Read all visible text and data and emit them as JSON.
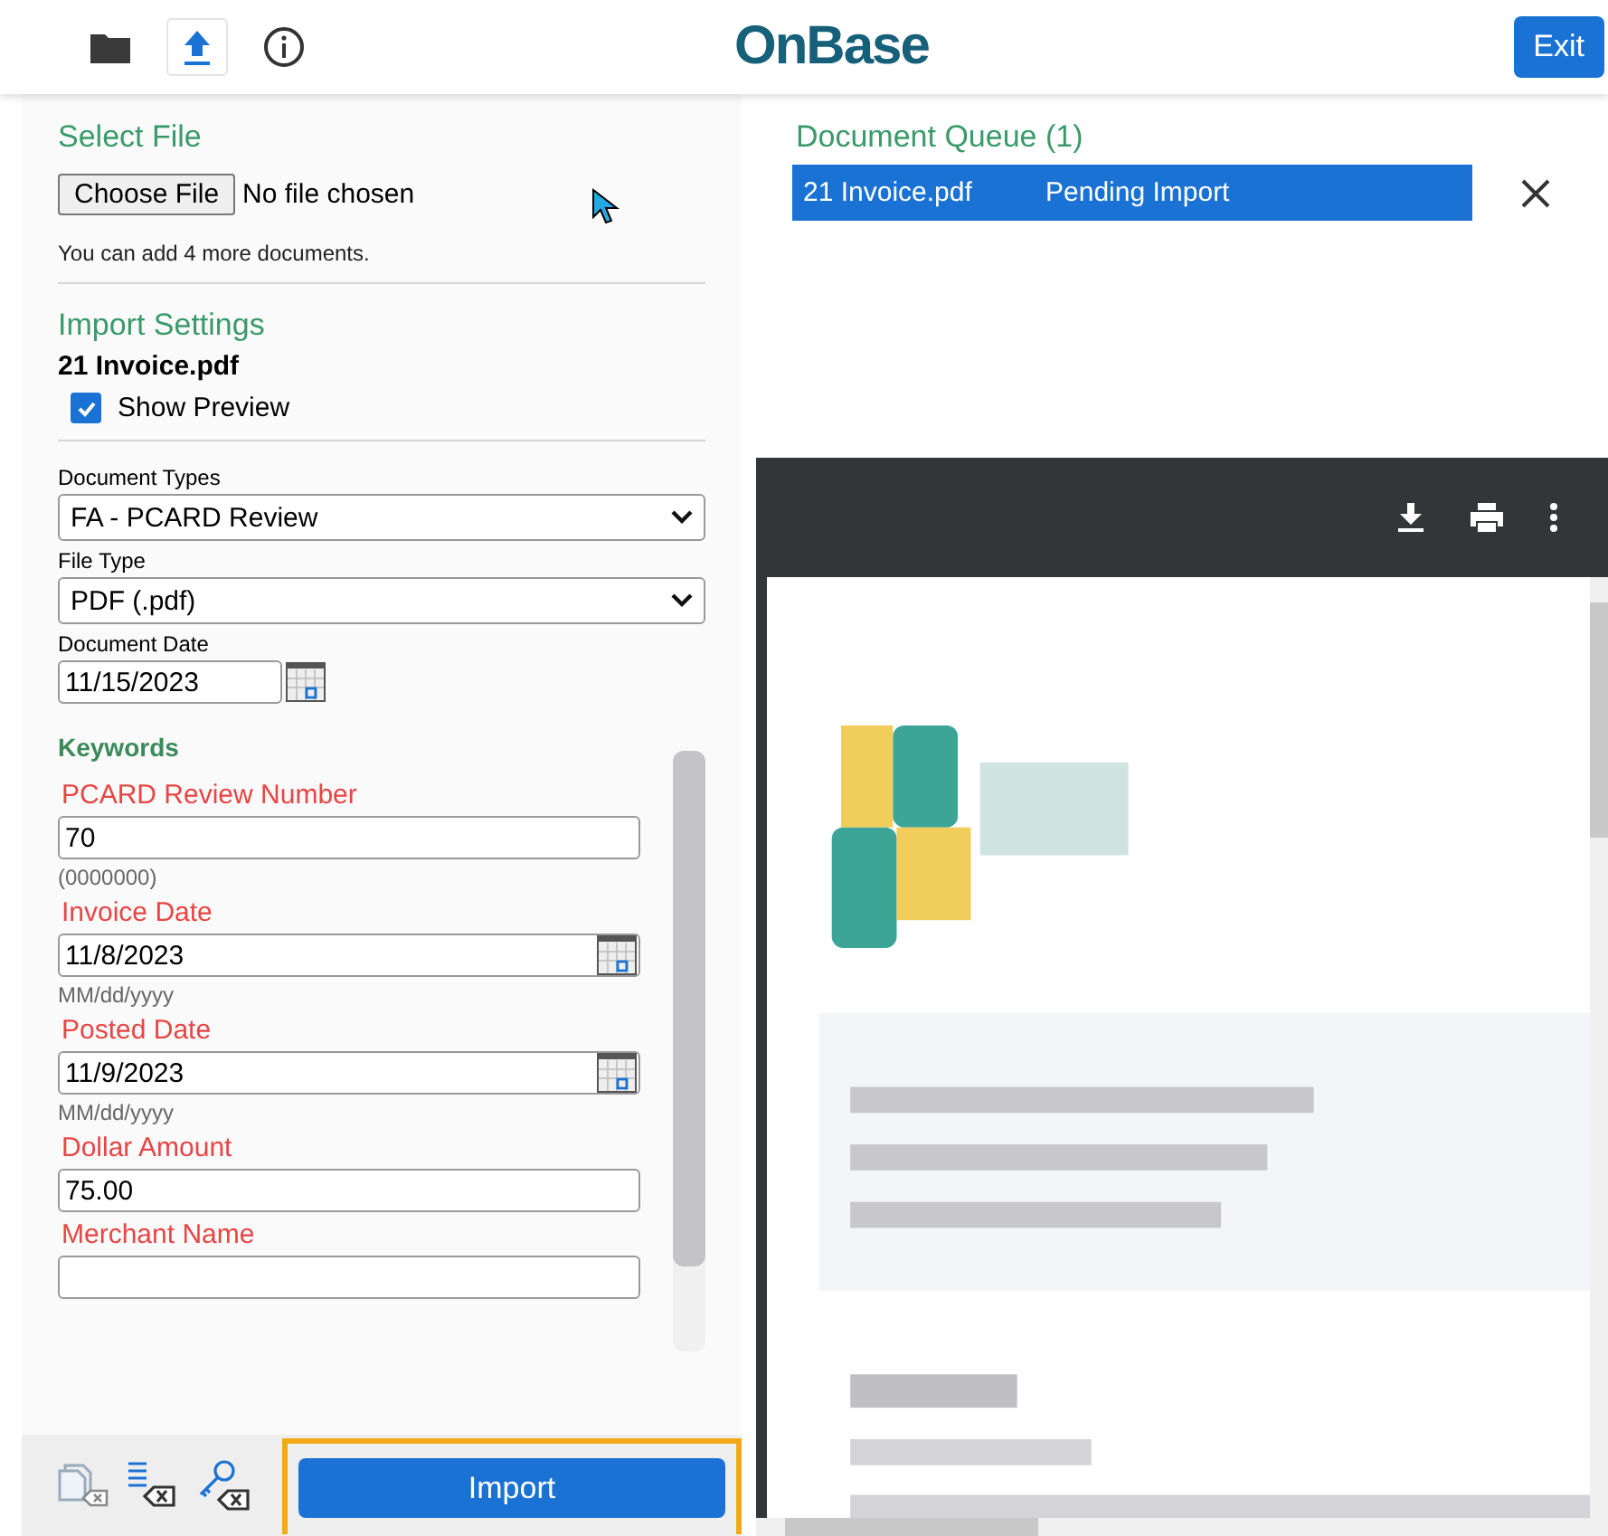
{
  "header": {
    "logo": "OnBase",
    "exit_button": "Exit",
    "toolbar": [
      {
        "kind": "folder",
        "selected": false
      },
      {
        "kind": "upload",
        "selected": true
      },
      {
        "kind": "info",
        "selected": false
      }
    ]
  },
  "select_file": {
    "title": "Select File",
    "choose_button": "Choose File",
    "file_status": "No file chosen",
    "hint": "You can add 4 more documents."
  },
  "import_settings": {
    "title": "Import Settings",
    "file_name": "21 Invoice.pdf",
    "show_preview": {
      "label": "Show Preview",
      "checked": true
    }
  },
  "fields": [
    {
      "label": "Document Types",
      "kind": "select",
      "value": "FA - PCARD Review"
    },
    {
      "label": "File Type",
      "kind": "select",
      "value": "PDF (.pdf)"
    },
    {
      "label": "Document Date",
      "kind": "date",
      "value": "11/15/2023"
    }
  ],
  "keywords": {
    "title": "Keywords",
    "items": [
      {
        "label": "PCARD Review Number",
        "kind": "text",
        "value": "70",
        "hint": "(0000000)"
      },
      {
        "label": "Invoice Date",
        "kind": "date",
        "value": "11/8/2023",
        "hint": "MM/dd/yyyy"
      },
      {
        "label": "Posted Date",
        "kind": "date",
        "value": "11/9/2023",
        "hint": "MM/dd/yyyy"
      },
      {
        "label": "Dollar Amount",
        "kind": "text",
        "value": "75.00"
      },
      {
        "label": "Merchant Name",
        "kind": "text",
        "value": ""
      }
    ]
  },
  "import_button": "Import",
  "queue": {
    "title": "Document Queue (1)",
    "items": [
      {
        "name": "21 Invoice.pdf",
        "status": "Pending Import",
        "selected": true
      }
    ]
  }
}
